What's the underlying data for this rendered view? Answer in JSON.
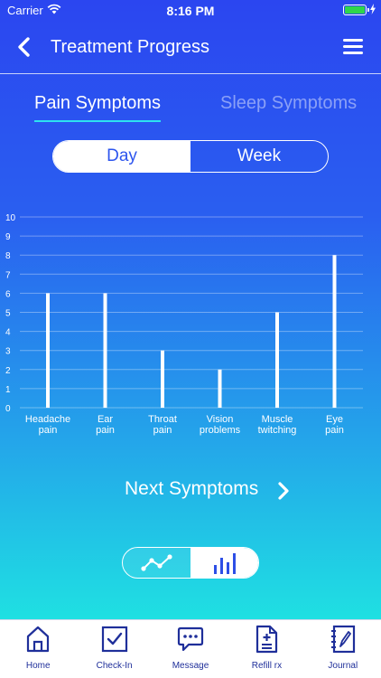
{
  "status_bar": {
    "carrier": "Carrier",
    "time": "8:16 PM"
  },
  "nav": {
    "title": "Treatment Progress"
  },
  "tabs": [
    {
      "label": "Pain Symptoms",
      "active": true
    },
    {
      "label": "Sleep Symptoms",
      "active": false
    }
  ],
  "range": {
    "day_label": "Day",
    "week_label": "Week",
    "selected": "Day"
  },
  "chart_data": {
    "type": "bar",
    "categories": [
      "Headache\npain",
      "Ear\npain",
      "Throat\npain",
      "Vision\nproblems",
      "Muscle\ntwitching",
      "Eye\npain"
    ],
    "values": [
      6,
      6,
      3,
      2,
      5,
      8
    ],
    "ylim": [
      0,
      10
    ],
    "yticks": [
      0,
      1,
      2,
      3,
      4,
      5,
      6,
      7,
      8,
      9,
      10
    ],
    "grid": true,
    "color": "#ffffff"
  },
  "next_symptoms": {
    "label": "Next Symptoms"
  },
  "chart_toggle": {
    "selected": "bar"
  },
  "tab_bar": {
    "items": [
      {
        "label": "Home",
        "icon": "home-icon"
      },
      {
        "label": "Check-In",
        "icon": "check-in-icon"
      },
      {
        "label": "Message",
        "icon": "message-icon"
      },
      {
        "label": "Refill rx",
        "icon": "refill-icon"
      },
      {
        "label": "Journal",
        "icon": "journal-icon"
      }
    ],
    "color": "#1f2f9a"
  }
}
